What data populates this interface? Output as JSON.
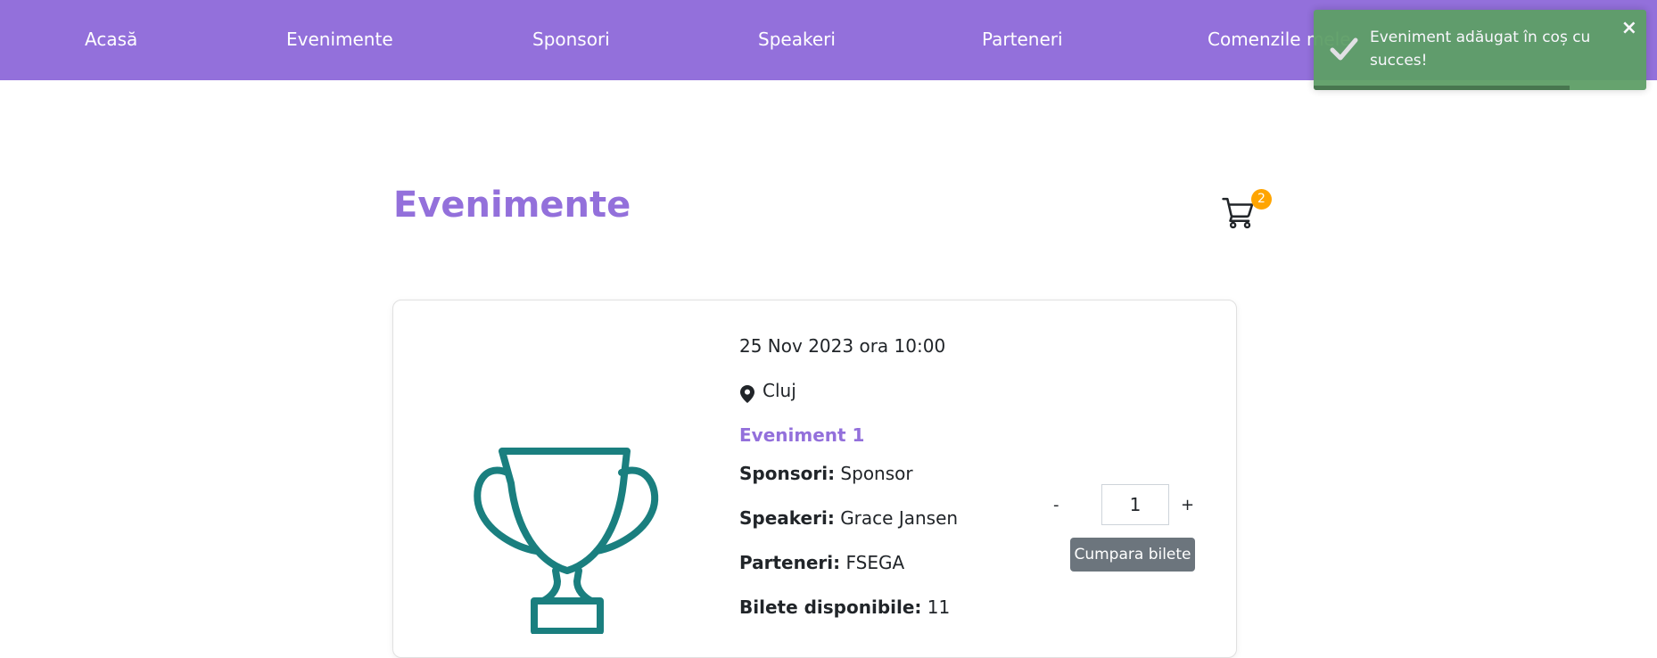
{
  "navbar": {
    "items": [
      {
        "label": "Acasă"
      },
      {
        "label": "Evenimente"
      },
      {
        "label": "Sponsori"
      },
      {
        "label": "Speakeri"
      },
      {
        "label": "Parteneri"
      },
      {
        "label": "Comenzile mele"
      }
    ]
  },
  "page": {
    "title": "Evenimente"
  },
  "cart": {
    "count": "2",
    "icon": "shopping-cart-icon"
  },
  "event": {
    "image_icon": "trophy-icon",
    "datetime": "25 Nov 2023 ora 10:00",
    "location": "Cluj",
    "name": "Eveniment 1",
    "sponsors_label": "Sponsori:",
    "sponsors": "Sponsor",
    "speakers_label": "Speakeri:",
    "speakers": "Grace Jansen",
    "partners_label": "Parteneri:",
    "partners": "FSEGA",
    "tickets_label": "Bilete disponibile:",
    "tickets": "11",
    "quantity": "1",
    "minus": "-",
    "plus": "+",
    "buy_label": "Cumpara bilete"
  },
  "toast": {
    "message": "Eveniment adăugat în coș cu succes!",
    "close": "×",
    "progress": 0.77
  },
  "colors": {
    "brand": "#9370db",
    "trophy": "#1a7f7f",
    "badge": "#ffa500",
    "toast": "#5e9f67",
    "button": "#6c757d"
  }
}
